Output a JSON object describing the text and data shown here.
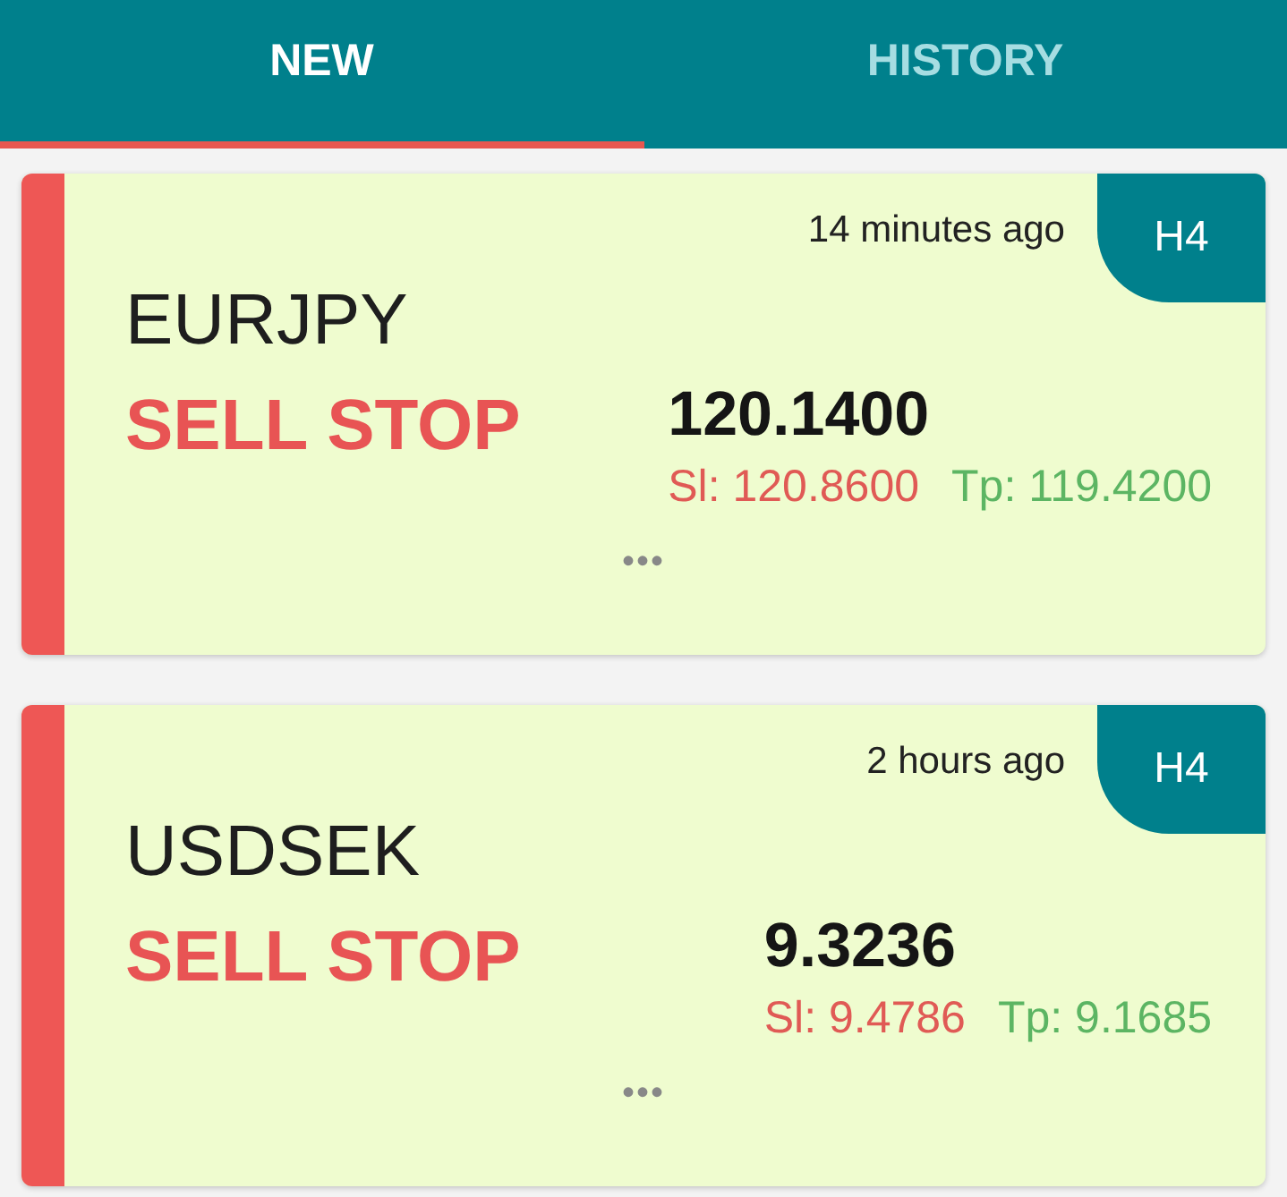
{
  "tabs": [
    {
      "label": "NEW",
      "selected": true
    },
    {
      "label": "HISTORY",
      "selected": false
    }
  ],
  "signals": [
    {
      "time": "14 minutes ago",
      "timeframe": "H4",
      "symbol": "EURJPY",
      "action": "SELL STOP",
      "price": "120.1400",
      "sl": "Sl: 120.8600",
      "tp": "Tp: 119.4200",
      "more": "•••"
    },
    {
      "time": "2 hours ago",
      "timeframe": "H4",
      "symbol": "USDSEK",
      "action": "SELL STOP",
      "price": "9.3236",
      "sl": "Sl: 9.4786",
      "tp": "Tp: 9.1685",
      "more": "•••"
    }
  ]
}
